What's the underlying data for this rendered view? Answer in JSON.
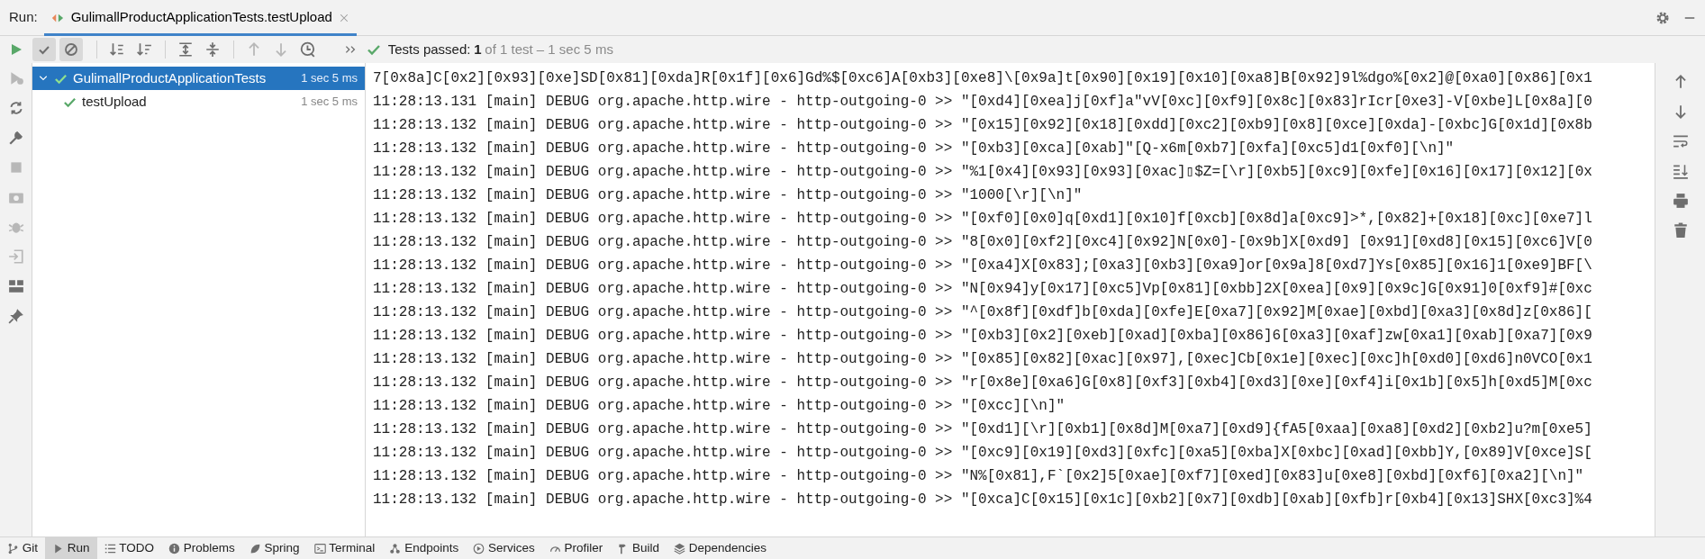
{
  "header": {
    "panel_label": "Run:",
    "tab": {
      "title": "GulimallProductApplicationTests.testUpload",
      "selected": true
    }
  },
  "toggles": [
    {
      "on": true
    },
    {
      "on": true
    }
  ],
  "status": {
    "label": "Tests passed:",
    "count": "1",
    "detail": "of 1 test – 1 sec 5 ms"
  },
  "tree": [
    {
      "name": "GulimallProductApplicationTests",
      "time": "1 sec 5 ms",
      "selected": true,
      "expanded": true,
      "children": [
        {
          "name": "testUpload",
          "time": "1 sec 5 ms",
          "selected": false
        }
      ]
    }
  ],
  "log": [
    "7[0x8a]C[0x2][0x93][0xe]SD[0x81][0xda]R[0x1f][0x6]Gd%$[0xc6]A[0xb3][0xe8]\\[0x9a]t[0x90][0x19][0x10][0xa8]B[0x92]9l%dgo%[0x2]@[0xa0][0x86][0x1",
    "11:28:13.131 [main] DEBUG org.apache.http.wire - http-outgoing-0 >> \"[0xd4][0xea]j[0xf]a\"vV[0xc][0xf9][0x8c][0x83]rIcr[0xe3]-V[0xbe]L[0x8a][0",
    "11:28:13.132 [main] DEBUG org.apache.http.wire - http-outgoing-0 >> \"[0x15][0x92][0x18][0xdd][0xc2][0xb9][0x8][0xce][0xda]-[0xbc]G[0x1d][0x8b",
    "11:28:13.132 [main] DEBUG org.apache.http.wire - http-outgoing-0 >> \"[0xb3][0xca][0xab]\"[Q-x6m[0xb7][0xfa][0xc5]d1[0xf0][\\n]\"",
    "11:28:13.132 [main] DEBUG org.apache.http.wire - http-outgoing-0 >> \"%1[0x4][0x93][0x93][0xac]▯$Z=[\\r][0xb5][0xc9][0xfe][0x16][0x17][0x12][0x",
    "11:28:13.132 [main] DEBUG org.apache.http.wire - http-outgoing-0 >> \"1000[\\r][\\n]\"",
    "11:28:13.132 [main] DEBUG org.apache.http.wire - http-outgoing-0 >> \"[0xf0][0x0]q[0xd1][0x10]f[0xcb][0x8d]a[0xc9]>*,[0x82]+[0x18][0xc][0xe7]l",
    "11:28:13.132 [main] DEBUG org.apache.http.wire - http-outgoing-0 >> \"8[0x0][0xf2][0xc4][0x92]N[0x0]-[0x9b]X[0xd9] [0x91][0xd8][0x15][0xc6]V[0",
    "11:28:13.132 [main] DEBUG org.apache.http.wire - http-outgoing-0 >> \"[0xa4]X[0x83];[0xa3][0xb3][0xa9]or[0x9a]8[0xd7]Ys[0x85][0x16]1[0xe9]BF[\\",
    "11:28:13.132 [main] DEBUG org.apache.http.wire - http-outgoing-0 >> \"N[0x94]y[0x17][0xc5]Vp[0x81][0xbb]2X[0xea][0x9][0x9c]G[0x91]0[0xf9]#[0xc",
    "11:28:13.132 [main] DEBUG org.apache.http.wire - http-outgoing-0 >> \"^[0x8f][0xdf]b[0xda][0xfe]E[0xa7][0x92]M[0xae][0xbd][0xa3][0x8d]z[0x86][",
    "11:28:13.132 [main] DEBUG org.apache.http.wire - http-outgoing-0 >> \"[0xb3][0x2][0xeb][0xad][0xba][0x86]6[0xa3][0xaf]zw[0xa1][0xab][0xa7][0x9",
    "11:28:13.132 [main] DEBUG org.apache.http.wire - http-outgoing-0 >> \"[0x85][0x82][0xac][0x97],[0xec]Cb[0x1e][0xec][0xc]h[0xd0][0xd6]n0VCO[0x1",
    "11:28:13.132 [main] DEBUG org.apache.http.wire - http-outgoing-0 >> \"r[0x8e][0xa6]G[0x8][0xf3][0xb4][0xd3][0xe][0xf4]i[0x1b][0x5]h[0xd5]M[0xc",
    "11:28:13.132 [main] DEBUG org.apache.http.wire - http-outgoing-0 >> \"[0xcc][\\n]\"",
    "11:28:13.132 [main] DEBUG org.apache.http.wire - http-outgoing-0 >> \"[0xd1][\\r][0xb1][0x8d]M[0xa7][0xd9]{fA5[0xaa][0xa8][0xd2][0xb2]u?m[0xe5]",
    "11:28:13.132 [main] DEBUG org.apache.http.wire - http-outgoing-0 >> \"[0xc9][0x19][0xd3][0xfc][0xa5][0xba]X[0xbc][0xad][0xbb]Y,[0x89]V[0xce]S[",
    "11:28:13.132 [main] DEBUG org.apache.http.wire - http-outgoing-0 >> \"N%[0x81],F`[0x2]5[0xae][0xf7][0xed][0x83]u[0xe8][0xbd][0xf6][0xa2][\\n]\"",
    "11:28:13.132 [main] DEBUG org.apache.http.wire - http-outgoing-0 >> \"[0xca]C[0x15][0x1c][0xb2][0x7][0xdb][0xab][0xfb]r[0xb4][0x13]SHX[0xc3]%4"
  ],
  "tool_windows": [
    {
      "label": "Git",
      "selected": false
    },
    {
      "label": "Run",
      "selected": true
    },
    {
      "label": "TODO",
      "selected": false
    },
    {
      "label": "Problems",
      "selected": false
    },
    {
      "label": "Spring",
      "selected": false
    },
    {
      "label": "Terminal",
      "selected": false
    },
    {
      "label": "Endpoints",
      "selected": false
    },
    {
      "label": "Services",
      "selected": false
    },
    {
      "label": "Profiler",
      "selected": false
    },
    {
      "label": "Build",
      "selected": false
    },
    {
      "label": "Dependencies",
      "selected": false
    }
  ]
}
